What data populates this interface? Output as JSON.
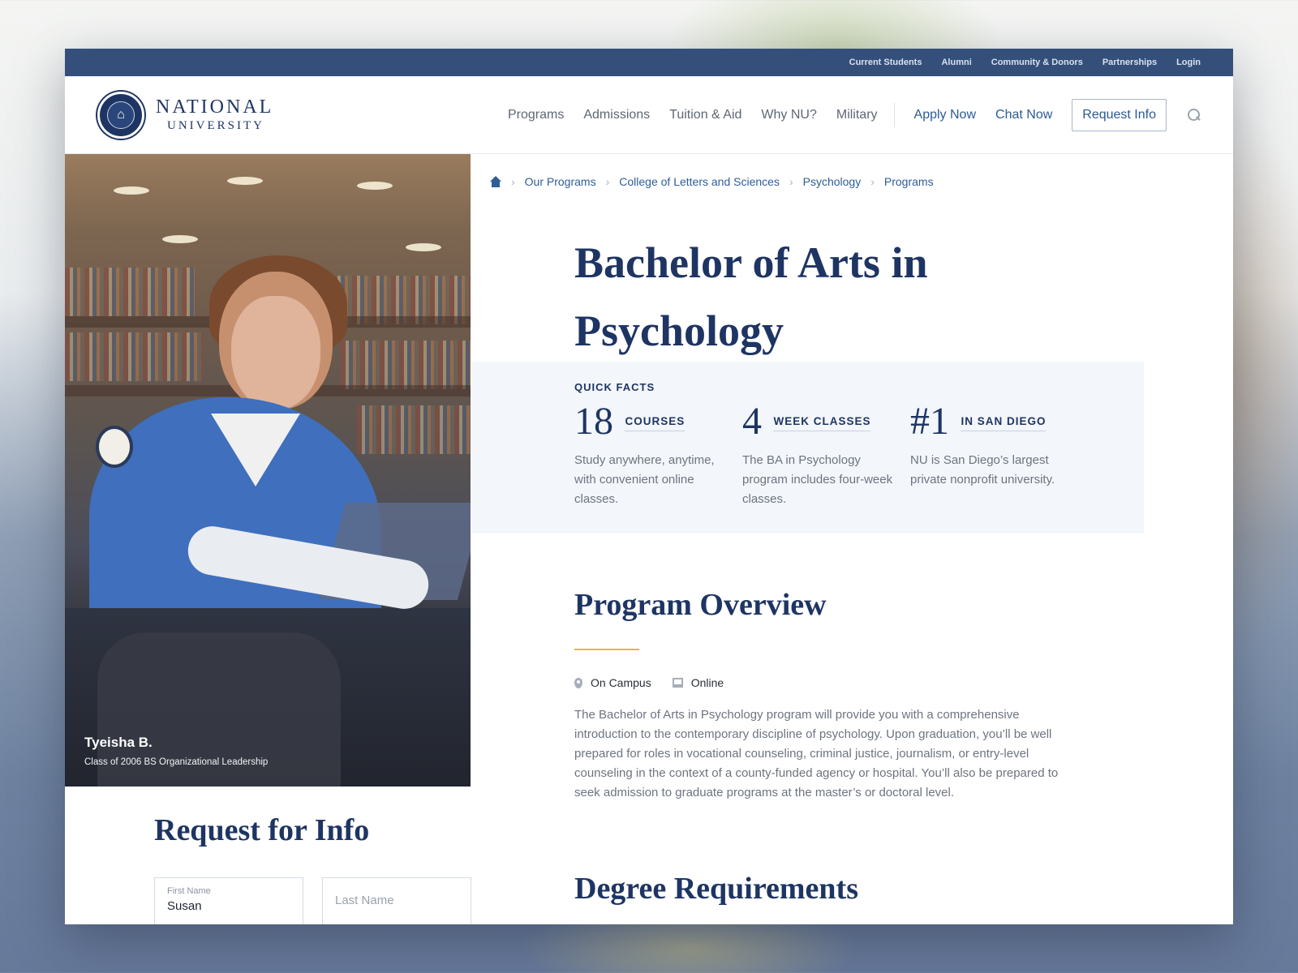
{
  "top_bar": {
    "links": [
      "Current Students",
      "Alumni",
      "Community & Donors",
      "Partnerships",
      "Login"
    ]
  },
  "header": {
    "logo_line1": "NATIONAL",
    "logo_line2": "UNIVERSITY",
    "logo_seal_text": "NATIONAL UNIVERSITY",
    "nav": [
      "Programs",
      "Admissions",
      "Tuition & Aid",
      "Why NU?",
      "Military"
    ],
    "apply_now": "Apply Now",
    "chat_now": "Chat Now",
    "request_info": "Request Info",
    "search_icon": "search-icon"
  },
  "hero_photo": {
    "name": "Tyeisha B.",
    "subtitle": "Class of 2006 BS Organizational Leadership"
  },
  "breadcrumb": {
    "home_icon": "home-icon",
    "items": [
      "Our Programs",
      "College of Letters and Sciences",
      "Psychology",
      "Programs"
    ]
  },
  "page": {
    "title": "Bachelor of Arts in Psychology"
  },
  "quick_facts": {
    "label": "QUICK FACTS",
    "facts": [
      {
        "number": "18",
        "unit": "COURSES",
        "description": "Study anywhere, anytime, with convenient online classes."
      },
      {
        "number": "4",
        "unit": "WEEK CLASSES",
        "description": "The BA in Psychology program includes four-week classes."
      },
      {
        "number": "#1",
        "unit": "IN SAN DIEGO",
        "description": "NU is San Diego’s largest private nonprofit university."
      }
    ]
  },
  "overview": {
    "heading": "Program Overview",
    "modes": [
      "On Campus",
      "Online"
    ],
    "paragraph": "The Bachelor of Arts in Psychology program will provide you with a comprehensive introduction to the contemporary discipline of psychology. Upon graduation, you’ll be well prepared for roles in vocational counseling, criminal justice, journalism, or entry-level counseling in the context of a county-funded agency or hospital. You’ll also be prepared to seek admission to graduate programs at the master’s or doctoral level."
  },
  "degree_requirements": {
    "heading": "Degree Requirements"
  },
  "request_form": {
    "heading": "Request for Info",
    "first_name_label": "First Name",
    "first_name_value": "Susan",
    "last_name_placeholder": "Last Name"
  },
  "colors": {
    "top_bar": "#34507a",
    "heading_navy": "#1e3563",
    "link_blue": "#2b5a96",
    "accent_gold": "#f2b233",
    "facts_bg": "#f3f6fa"
  }
}
